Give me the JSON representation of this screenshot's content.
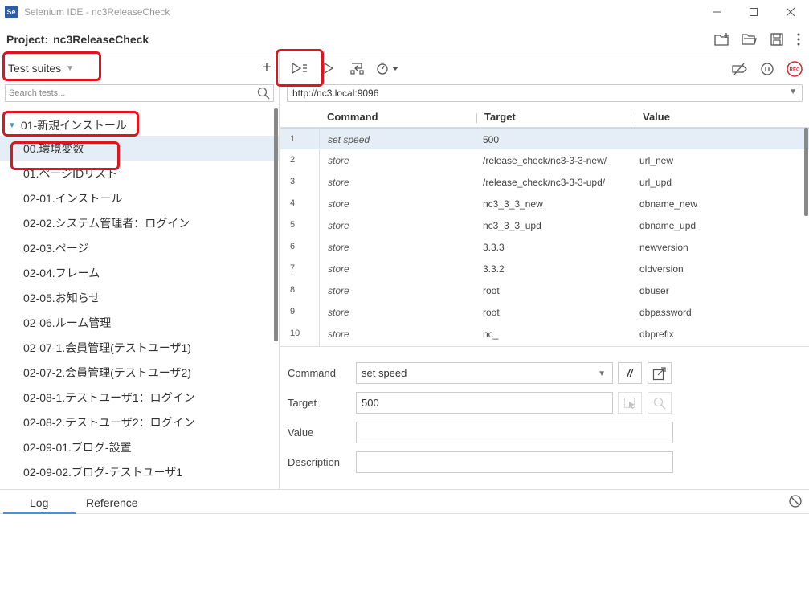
{
  "window": {
    "logo": "Se",
    "title": "Selenium IDE - nc3ReleaseCheck",
    "controls": [
      "minimize-icon",
      "maximize-icon",
      "close-icon"
    ]
  },
  "project": {
    "label": "Project:",
    "name": "nc3ReleaseCheck",
    "tools": [
      "new-project-icon",
      "open-folder-icon",
      "save-icon",
      "more-icon"
    ]
  },
  "sidebar": {
    "dropdown_label": "Test suites",
    "add_label": "+",
    "search_placeholder": "Search tests...",
    "suite_name": "01-新規インストール",
    "tests": [
      "00.環境変数",
      "01.ページIDリスト",
      "02-01.インストール",
      "02-02.システム管理者：ログイン",
      "02-03.ページ",
      "02-04.フレーム",
      "02-05.お知らせ",
      "02-06.ルーム管理",
      "02-07-1.会員管理(テストユーザ1)",
      "02-07-2.会員管理(テストユーザ2)",
      "02-08-1.テストユーザ1：ログイン",
      "02-08-2.テストユーザ2：ログイン",
      "02-09-01.ブログ-設置",
      "02-09-02.ブログ-テストユーザ1"
    ],
    "selected_index": 0
  },
  "toolbar": {
    "icons": [
      "run-all-tests-icon",
      "run-current-test-icon",
      "step-over-icon",
      "speed-icon"
    ],
    "right_icons": [
      "disable-breakpoints-icon",
      "pause-icon",
      "record-icon"
    ],
    "record_label": "REC"
  },
  "url": {
    "value": "http://nc3.local:9096"
  },
  "table": {
    "headers": {
      "command": "Command",
      "target": "Target",
      "value": "Value"
    },
    "rows": [
      {
        "num": "1",
        "command": "set speed",
        "target": "500",
        "value": ""
      },
      {
        "num": "2",
        "command": "store",
        "target": "/release_check/nc3-3-3-new/",
        "value": "url_new"
      },
      {
        "num": "3",
        "command": "store",
        "target": "/release_check/nc3-3-3-upd/",
        "value": "url_upd"
      },
      {
        "num": "4",
        "command": "store",
        "target": "nc3_3_3_new",
        "value": "dbname_new"
      },
      {
        "num": "5",
        "command": "store",
        "target": "nc3_3_3_upd",
        "value": "dbname_upd"
      },
      {
        "num": "6",
        "command": "store",
        "target": "3.3.3",
        "value": "newversion"
      },
      {
        "num": "7",
        "command": "store",
        "target": "3.3.2",
        "value": "oldversion"
      },
      {
        "num": "8",
        "command": "store",
        "target": "root",
        "value": "dbuser"
      },
      {
        "num": "9",
        "command": "store",
        "target": "root",
        "value": "dbpassword"
      },
      {
        "num": "10",
        "command": "store",
        "target": "nc_",
        "value": "dbprefix"
      }
    ],
    "selected_index": 0
  },
  "editor": {
    "command_label": "Command",
    "command_value": "set speed",
    "comment_label": "//",
    "target_label": "Target",
    "target_value": "500",
    "value_label": "Value",
    "value_value": "",
    "description_label": "Description",
    "description_value": ""
  },
  "log": {
    "tabs": [
      "Log",
      "Reference"
    ],
    "active_tab": "Log"
  },
  "colors": {
    "accent": "#4a90d9",
    "selected_row": "#e5eef7",
    "highlight": "#e0141e",
    "record": "#d9262c"
  }
}
